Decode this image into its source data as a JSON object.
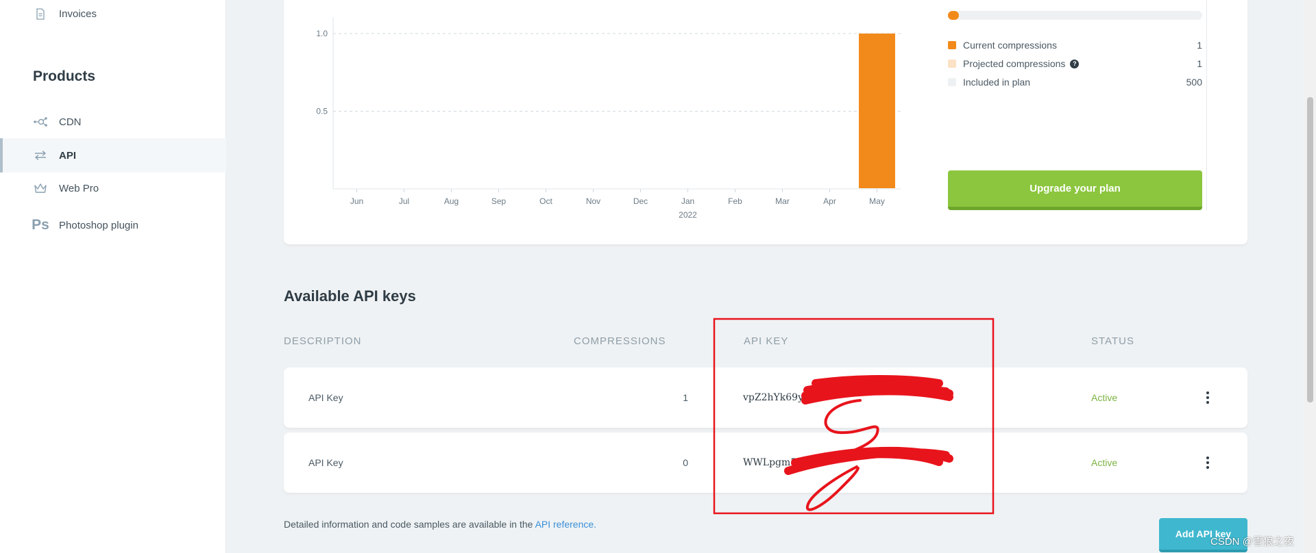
{
  "sidebar": {
    "invoices_label": "Invoices",
    "products_heading": "Products",
    "items": [
      {
        "label": "CDN",
        "icon": "cdn-network-icon"
      },
      {
        "label": "API",
        "icon": "swap-arrows-icon"
      },
      {
        "label": "Web Pro",
        "icon": "crown-icon"
      },
      {
        "label": "Photoshop plugin",
        "icon": "photoshop-icon",
        "glyph": "Ps"
      }
    ]
  },
  "usage": {
    "progress_fraction": 0.005,
    "legend": [
      {
        "label": "Current compressions",
        "value": "1",
        "color": "#f28a1b"
      },
      {
        "label": "Projected compressions",
        "value": "1",
        "color": "#fbe1c6"
      },
      {
        "label": "Included in plan",
        "value": "500",
        "color": "#eef1f3"
      }
    ],
    "help_glyph": "?",
    "upgrade_label": "Upgrade your plan"
  },
  "chart_data": {
    "type": "bar",
    "categories": [
      "Jun",
      "Jul",
      "Aug",
      "Sep",
      "Oct",
      "Nov",
      "Dec",
      "Jan",
      "Feb",
      "Mar",
      "Apr",
      "May"
    ],
    "year_label": "2022",
    "values": [
      0,
      0,
      0,
      0,
      0,
      0,
      0,
      0,
      0,
      0,
      0,
      1
    ],
    "y_ticks": [
      "0.5",
      "1.0"
    ],
    "ylim": [
      0,
      1.0
    ],
    "grid": true,
    "bar_color": "#f28a1b"
  },
  "api_keys": {
    "title": "Available API keys",
    "headers": {
      "description": "DESCRIPTION",
      "compressions": "COMPRESSIONS",
      "api_key": "API KEY",
      "status": "STATUS"
    },
    "rows": [
      {
        "description": "API Key",
        "compressions": "1",
        "key": "vpZ2hYk69y",
        "status": "Active"
      },
      {
        "description": "API Key",
        "compressions": "0",
        "key": "WWLpgm5f5ss",
        "status": "Active"
      }
    ],
    "footnote_text": "Detailed information and code samples are available in the ",
    "footnote_link": "API reference.",
    "add_label": "Add API key"
  },
  "watermark": "CSDN @雪狼之夜",
  "colors": {
    "accent_orange": "#f28a1b",
    "upgrade_green": "#8cc63e",
    "add_teal": "#3fb8cf",
    "status_active": "#7cb342",
    "annotation_red": "#e8141c"
  }
}
